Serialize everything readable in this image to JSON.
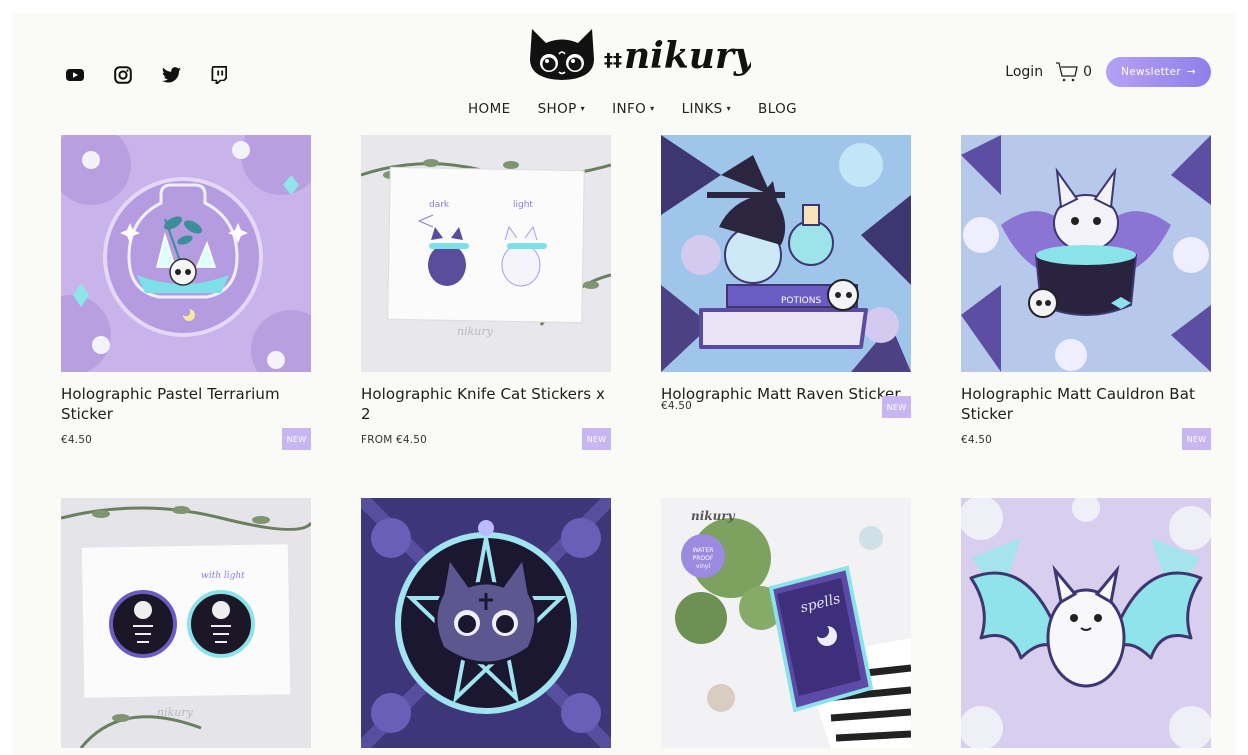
{
  "brand": {
    "logo_text": "nikury"
  },
  "social": [
    {
      "name": "youtube-icon"
    },
    {
      "name": "instagram-icon"
    },
    {
      "name": "twitter-icon"
    },
    {
      "name": "twitch-icon"
    }
  ],
  "nav": {
    "home": "HOME",
    "shop": "SHOP",
    "info": "INFO",
    "links": "LINKS",
    "blog": "BLOG",
    "caret": "▾"
  },
  "account": {
    "login": "Login",
    "cart_count": "0",
    "newsletter": "Newsletter",
    "arrow": "→"
  },
  "colors": {
    "accent": "#9d8df0",
    "badge": "#c8b6f2",
    "lavender": "#b9a6e6",
    "aqua": "#7fe0e8"
  },
  "products": [
    {
      "title": "Holographic Pastel Terrarium Sticker",
      "price": "€4.50",
      "badge": "NEW"
    },
    {
      "title": "Holographic Knife Cat Stickers x 2",
      "price": "FROM €4.50",
      "badge": "NEW",
      "img_text_dark": "dark",
      "img_text_light": "light",
      "img_watermark": "nikury"
    },
    {
      "title": "Holographic Matt Raven Sticker",
      "price": "€4.50",
      "badge": "NEW",
      "img_label": "POTIONS"
    },
    {
      "title": "Holographic Matt Cauldron Bat Sticker",
      "price": "€4.50",
      "badge": "NEW"
    },
    {
      "img_text": "with light",
      "img_watermark": "nikury"
    },
    {},
    {
      "img_watermark": "nikury",
      "img_badge_lines": [
        "WATER",
        "PROOF",
        "vinyl"
      ],
      "img_book_title": "spells"
    },
    {}
  ]
}
